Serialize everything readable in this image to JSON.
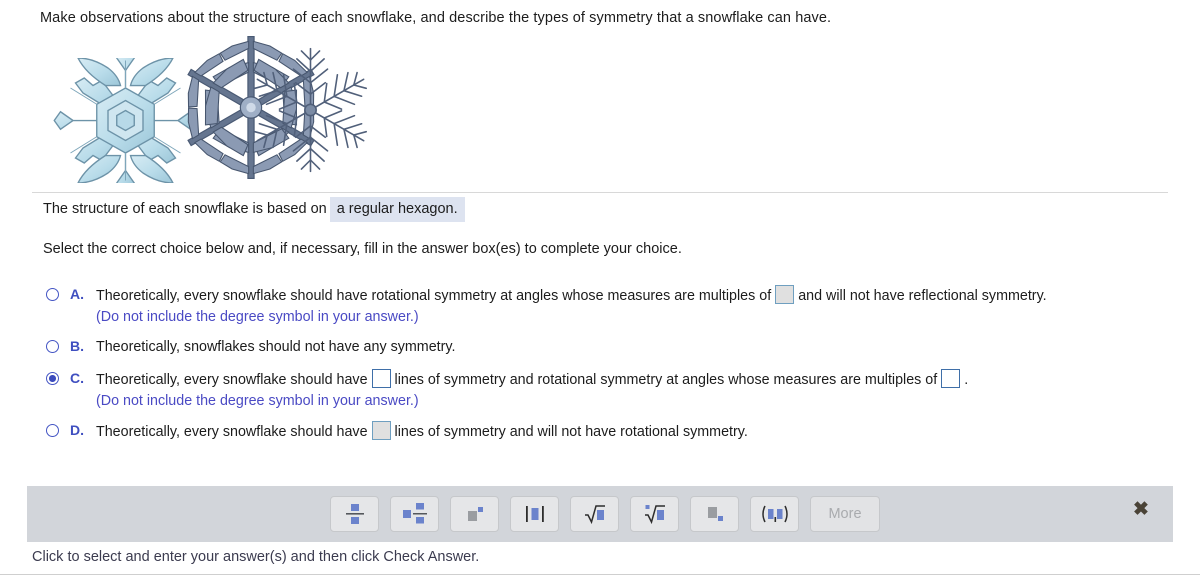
{
  "prompt": "Make observations about the structure of each snowflake, and describe the types of symmetry that a snowflake can have.",
  "images": {
    "alt_1": "snowflake-plate-hexagonal",
    "alt_2": "snowflake-stellar-dendrite",
    "alt_3": "snowflake-fernlike-dendrite"
  },
  "structure": {
    "lead": "The structure of each snowflake is based on",
    "answer": "a regular hexagon."
  },
  "instruction": "Select the correct choice below and, if necessary, fill in the answer box(es) to complete your choice.",
  "choices": [
    {
      "letter": "A.",
      "selected": false,
      "text_before": "Theoretically, every snowflake should have rotational symmetry at angles whose measures are multiples of",
      "text_after": "and will not have reflectional symmetry.",
      "note": "(Do not include the degree symbol in your answer.)",
      "box_count": 1
    },
    {
      "letter": "B.",
      "selected": false,
      "text_before": "Theoretically, snowflakes should not have any symmetry.",
      "text_after": "",
      "note": "",
      "box_count": 0
    },
    {
      "letter": "C.",
      "selected": true,
      "text_before": "Theoretically, every snowflake should have",
      "text_mid": "lines of symmetry and rotational symmetry at angles whose measures are multiples of",
      "text_after": ".",
      "note": "(Do not include the degree symbol in your answer.)",
      "box_count": 2
    },
    {
      "letter": "D.",
      "selected": false,
      "text_before": "Theoretically, every snowflake should have",
      "text_after": "lines of symmetry and will not have rotational symmetry.",
      "note": "",
      "box_count": 1
    }
  ],
  "palette": {
    "buttons": [
      {
        "name": "fraction",
        "label": ""
      },
      {
        "name": "mixed-number",
        "label": ""
      },
      {
        "name": "exponent",
        "label": ""
      },
      {
        "name": "absolute-value",
        "label": ""
      },
      {
        "name": "square-root",
        "label": ""
      },
      {
        "name": "nth-root",
        "label": ""
      },
      {
        "name": "subscript",
        "label": ""
      },
      {
        "name": "ordered-pair",
        "label": ""
      }
    ],
    "more_label": "More",
    "close_label": "✖"
  },
  "footer": {
    "status": "Click to select and enter your answer(s) and then click Check Answer."
  },
  "colors": {
    "accent_blue": "#3f4fc0",
    "palette_bg": "#d2d5da",
    "highlight_bg": "#dde3f0",
    "glyph_blue": "#6b83cc"
  }
}
